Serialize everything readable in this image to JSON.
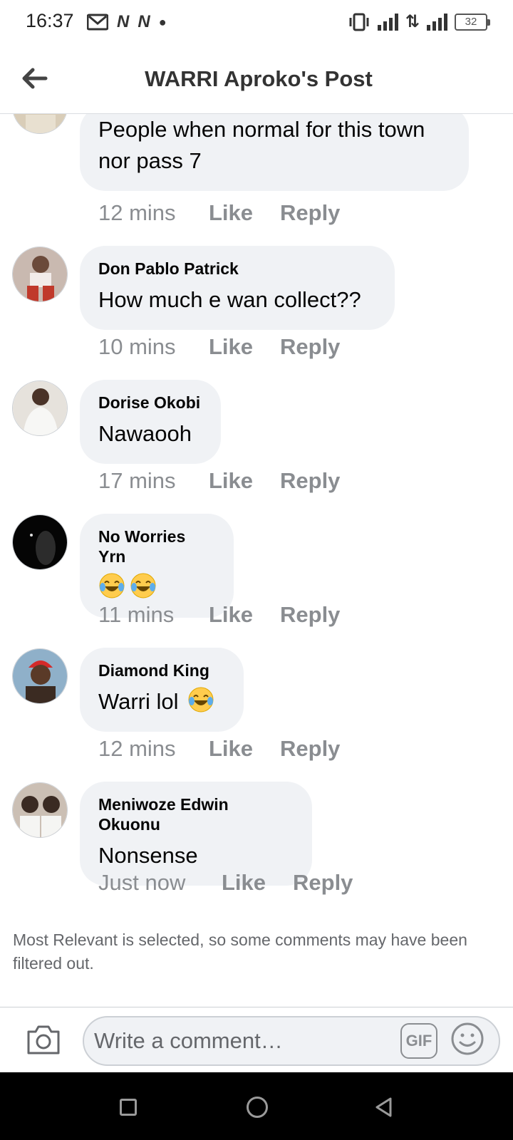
{
  "status_bar": {
    "time": "16:37",
    "icons_left": [
      "gmail-icon",
      "n-app-icon",
      "n-app-icon",
      "dot-icon"
    ],
    "icons_right": [
      "vibrate-icon",
      "signal-icon",
      "data-arrows-icon",
      "h-plus-signal-icon",
      "battery-icon"
    ],
    "battery_level": "32"
  },
  "header": {
    "title": "WARRI Aproko's Post",
    "back_icon": "back-arrow-icon"
  },
  "comments": [
    {
      "author": "",
      "text": "People when normal for this town nor pass 7",
      "time": "12 mins",
      "like_label": "Like",
      "reply_label": "Reply"
    },
    {
      "author": "Don Pablo Patrick",
      "text": "How much e wan collect??",
      "time": "10 mins",
      "like_label": "Like",
      "reply_label": "Reply"
    },
    {
      "author": "Dorise Okobi",
      "text": "Nawaooh",
      "time": "17 mins",
      "like_label": "Like",
      "reply_label": "Reply"
    },
    {
      "author": "No Worries Yrn",
      "text": "",
      "emoji": [
        "tears-of-joy-emoji",
        "tears-of-joy-emoji"
      ],
      "time": "11 mins",
      "like_label": "Like",
      "reply_label": "Reply"
    },
    {
      "author": "Diamond King",
      "text": "Warri lol",
      "emoji": [
        "tears-of-joy-emoji"
      ],
      "time": "12 mins",
      "like_label": "Like",
      "reply_label": "Reply"
    },
    {
      "author": "Meniwoze Edwin Okuonu",
      "text": "Nonsense",
      "time": "Just now",
      "like_label": "Like",
      "reply_label": "Reply"
    }
  ],
  "filter_note": "Most Relevant is selected, so some comments may have been filtered out.",
  "composer": {
    "placeholder": "Write a comment…",
    "gif_label": "GIF",
    "camera_icon": "camera-icon",
    "emoji_icon": "smiley-icon"
  },
  "nav_bar": {
    "icons": [
      "recent-apps-icon",
      "home-icon",
      "back-icon"
    ]
  },
  "colors": {
    "bubble": "#f0f2f5",
    "meta_text": "#8a8d91",
    "border": "#ccd0d5",
    "nav_background": "#000000"
  }
}
